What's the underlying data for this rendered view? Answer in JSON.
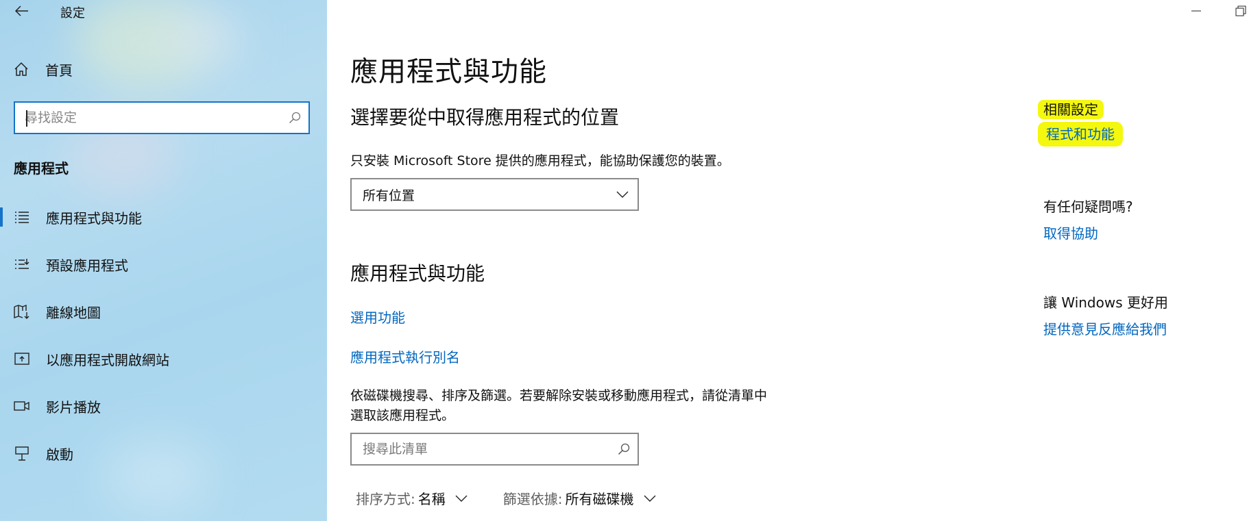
{
  "window": {
    "title": "設定",
    "back_icon": "arrow-left-icon",
    "minimize_icon": "minimize-icon",
    "restore_icon": "restore-icon"
  },
  "sidebar": {
    "home": {
      "icon": "home-icon",
      "label": "首頁"
    },
    "search": {
      "placeholder": "尋找設定",
      "value": "",
      "icon": "search-icon"
    },
    "section_heading": "應用程式",
    "items": [
      {
        "icon": "list-icon",
        "label": "應用程式與功能",
        "selected": true
      },
      {
        "icon": "default-list-icon",
        "label": "預設應用程式",
        "selected": false
      },
      {
        "icon": "offline-map-icon",
        "label": "離線地圖",
        "selected": false
      },
      {
        "icon": "open-website-icon",
        "label": "以應用程式開啟網站",
        "selected": false
      },
      {
        "icon": "video-icon",
        "label": "影片播放",
        "selected": false
      },
      {
        "icon": "startup-icon",
        "label": "啟動",
        "selected": false
      }
    ],
    "accent_color": "#1573c9"
  },
  "main": {
    "title": "應用程式與功能",
    "install_source": {
      "heading": "選擇要從中取得應用程式的位置",
      "description": "只安裝 Microsoft Store 提供的應用程式，能協助保護您的裝置。",
      "dropdown_value": "所有位置"
    },
    "apps": {
      "heading": "應用程式與功能",
      "optional_features_link": "選用功能",
      "app_alias_link": "應用程式執行別名",
      "description_line1": "依磁碟機搜尋、排序及篩選。若要解除安裝或移動應用程式，請從清單中",
      "description_line2": "選取該應用程式。",
      "search_placeholder": "搜尋此清單",
      "sort_label": "排序方式:",
      "sort_value": "名稱",
      "filter_label": "篩選依據:",
      "filter_value": "所有磁碟機"
    },
    "link_color": "#0067c0"
  },
  "right_panel": {
    "related_heading": "相關設定",
    "programs_link": "程式和功能",
    "highlight_color": "#f4f70e",
    "question_heading": "有任何疑問嗎?",
    "help_link": "取得協助",
    "improve_heading": "讓 Windows 更好用",
    "feedback_link": "提供意見反應給我們"
  }
}
